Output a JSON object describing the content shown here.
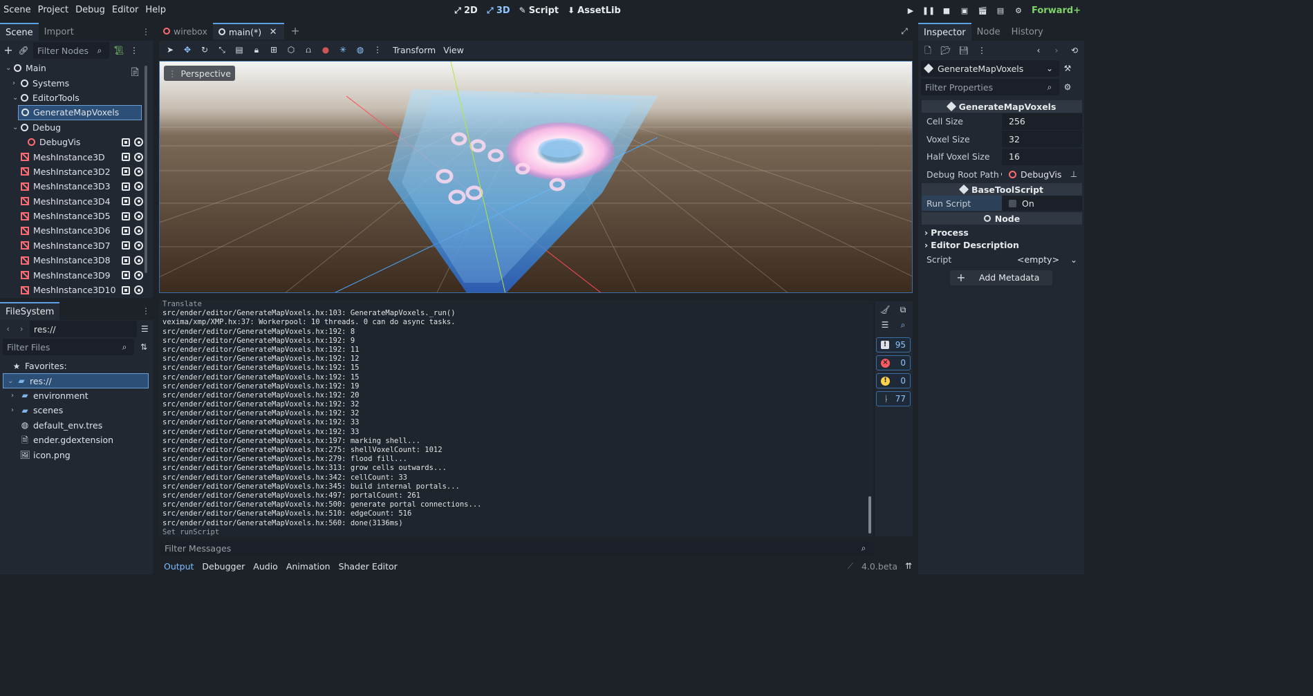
{
  "menu": [
    "Scene",
    "Project",
    "Debug",
    "Editor",
    "Help"
  ],
  "modes": [
    {
      "label": "2D",
      "active": false
    },
    {
      "label": "3D",
      "active": true
    },
    {
      "label": "Script",
      "active": false
    },
    {
      "label": "AssetLib",
      "active": false
    }
  ],
  "renderer": "Forward+",
  "scene_dock": {
    "tabs": [
      "Scene",
      "Import"
    ],
    "filter_placeholder": "Filter Nodes",
    "nodes": [
      {
        "label": "Main",
        "indent": 0,
        "icon": "node",
        "arrow": "v"
      },
      {
        "label": "Systems",
        "indent": 1,
        "icon": "node",
        "arrow": ">"
      },
      {
        "label": "EditorTools",
        "indent": 1,
        "icon": "node",
        "arrow": "v"
      },
      {
        "label": "GenerateMapVoxels",
        "indent": 2,
        "icon": "node",
        "arrow": "",
        "selected": true
      },
      {
        "label": "Debug",
        "indent": 1,
        "icon": "node",
        "arrow": "v"
      },
      {
        "label": "DebugVis",
        "indent": 2,
        "icon": "node-red",
        "arrow": "",
        "extras": true
      },
      {
        "label": "MeshInstance3D",
        "indent": 1,
        "icon": "mesh",
        "arrow": "",
        "extras": true
      },
      {
        "label": "MeshInstance3D2",
        "indent": 1,
        "icon": "mesh",
        "arrow": "",
        "extras": true
      },
      {
        "label": "MeshInstance3D3",
        "indent": 1,
        "icon": "mesh",
        "arrow": "",
        "extras": true
      },
      {
        "label": "MeshInstance3D4",
        "indent": 1,
        "icon": "mesh",
        "arrow": "",
        "extras": true
      },
      {
        "label": "MeshInstance3D5",
        "indent": 1,
        "icon": "mesh",
        "arrow": "",
        "extras": true
      },
      {
        "label": "MeshInstance3D6",
        "indent": 1,
        "icon": "mesh",
        "arrow": "",
        "extras": true
      },
      {
        "label": "MeshInstance3D7",
        "indent": 1,
        "icon": "mesh",
        "arrow": "",
        "extras": true
      },
      {
        "label": "MeshInstance3D8",
        "indent": 1,
        "icon": "mesh",
        "arrow": "",
        "extras": true
      },
      {
        "label": "MeshInstance3D9",
        "indent": 1,
        "icon": "mesh",
        "arrow": "",
        "extras": true
      },
      {
        "label": "MeshInstance3D10",
        "indent": 1,
        "icon": "mesh",
        "arrow": "",
        "extras": true
      }
    ]
  },
  "filesystem": {
    "title": "FileSystem",
    "path": "res://",
    "filter_placeholder": "Filter Files",
    "favorites_label": "Favorites:",
    "items": [
      {
        "label": "res://",
        "indent": 0,
        "icon": "folder",
        "arrow": "v",
        "selected": true
      },
      {
        "label": "environment",
        "indent": 1,
        "icon": "folder",
        "arrow": ">"
      },
      {
        "label": "scenes",
        "indent": 1,
        "icon": "folder",
        "arrow": ">"
      },
      {
        "label": "default_env.tres",
        "indent": 1,
        "icon": "globe",
        "arrow": ""
      },
      {
        "label": "ender.gdextension",
        "indent": 1,
        "icon": "file",
        "arrow": ""
      },
      {
        "label": "icon.png",
        "indent": 1,
        "icon": "image",
        "arrow": ""
      }
    ]
  },
  "editor_tabs": [
    {
      "label": "wirebox",
      "active": false
    },
    {
      "label": "main(*)",
      "active": true
    }
  ],
  "viewport": {
    "menus": [
      "Transform",
      "View"
    ],
    "perspective_label": "Perspective"
  },
  "output": {
    "lines": [
      {
        "text": "Translate",
        "dim": true
      },
      {
        "text": "src/ender/editor/GenerateMapVoxels.hx:103: GenerateMapVoxels._run()"
      },
      {
        "text": "vexima/xmp/XMP.hx:37: Workerpool: 10 threads. 0 can do async tasks."
      },
      {
        "text": "src/ender/editor/GenerateMapVoxels.hx:192: 8"
      },
      {
        "text": "src/ender/editor/GenerateMapVoxels.hx:192: 9"
      },
      {
        "text": "src/ender/editor/GenerateMapVoxels.hx:192: 11"
      },
      {
        "text": "src/ender/editor/GenerateMapVoxels.hx:192: 12"
      },
      {
        "text": "src/ender/editor/GenerateMapVoxels.hx:192: 15"
      },
      {
        "text": "src/ender/editor/GenerateMapVoxels.hx:192: 15"
      },
      {
        "text": "src/ender/editor/GenerateMapVoxels.hx:192: 19"
      },
      {
        "text": "src/ender/editor/GenerateMapVoxels.hx:192: 20"
      },
      {
        "text": "src/ender/editor/GenerateMapVoxels.hx:192: 32"
      },
      {
        "text": "src/ender/editor/GenerateMapVoxels.hx:192: 32"
      },
      {
        "text": "src/ender/editor/GenerateMapVoxels.hx:192: 33"
      },
      {
        "text": "src/ender/editor/GenerateMapVoxels.hx:192: 33"
      },
      {
        "text": "src/ender/editor/GenerateMapVoxels.hx:197: marking shell..."
      },
      {
        "text": "src/ender/editor/GenerateMapVoxels.hx:275: shellVoxelCount: 1012"
      },
      {
        "text": "src/ender/editor/GenerateMapVoxels.hx:279: flood fill..."
      },
      {
        "text": "src/ender/editor/GenerateMapVoxels.hx:313: grow cells outwards..."
      },
      {
        "text": "src/ender/editor/GenerateMapVoxels.hx:342: cellCount: 33"
      },
      {
        "text": "src/ender/editor/GenerateMapVoxels.hx:345: build internal portals..."
      },
      {
        "text": "src/ender/editor/GenerateMapVoxels.hx:497: portalCount: 261"
      },
      {
        "text": "src/ender/editor/GenerateMapVoxels.hx:500: generate portal connections..."
      },
      {
        "text": "src/ender/editor/GenerateMapVoxels.hx:510: edgeCount: 516"
      },
      {
        "text": "src/ender/editor/GenerateMapVoxels.hx:560: done(3136ms)"
      },
      {
        "text": "Set runScript",
        "dim": true
      }
    ],
    "filter_placeholder": "Filter Messages",
    "counts": {
      "messages": "95",
      "errors": "0",
      "warnings": "0",
      "editor": "77"
    }
  },
  "bottom_tabs": [
    {
      "label": "Output",
      "active": true
    },
    {
      "label": "Debugger",
      "active": false
    },
    {
      "label": "Audio",
      "active": false
    },
    {
      "label": "Animation",
      "active": false
    },
    {
      "label": "Shader Editor",
      "active": false
    }
  ],
  "version": "4.0.beta",
  "inspector": {
    "tabs": [
      "Inspector",
      "Node",
      "History"
    ],
    "object_name": "GenerateMapVoxels",
    "filter_placeholder": "Filter Properties",
    "class_header": "GenerateMapVoxels",
    "props": [
      {
        "label": "Cell Size",
        "value": "256"
      },
      {
        "label": "Voxel Size",
        "value": "32"
      },
      {
        "label": "Half Voxel Size",
        "value": "16"
      }
    ],
    "debug_root": {
      "label": "Debug Root Path",
      "value": "DebugVis"
    },
    "base_header": "BaseToolScript",
    "run_script": {
      "label": "Run Script",
      "value": "On"
    },
    "node_header": "Node",
    "groups": [
      "Process",
      "Editor Description"
    ],
    "script": {
      "label": "Script",
      "value": "<empty>"
    },
    "add_metadata": "Add Metadata"
  },
  "colors": {
    "accent": "#5aa3e8",
    "bg": "#1d2229",
    "panel": "#222832"
  }
}
